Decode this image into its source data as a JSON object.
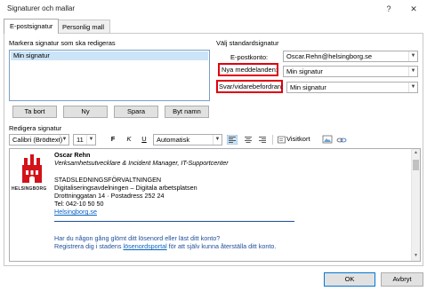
{
  "window": {
    "title": "Signaturer och mallar",
    "help": "?",
    "close": "✕"
  },
  "tabs": [
    {
      "label": "E-postsignatur",
      "active": true
    },
    {
      "label": "Personlig mall",
      "active": false
    }
  ],
  "left": {
    "select_label": "Markera signatur som ska redigeras",
    "signatures": [
      "Min signatur"
    ],
    "buttons": {
      "delete": "Ta bort",
      "new": "Ny",
      "save": "Spara",
      "rename": "Byt namn"
    }
  },
  "right": {
    "group_label": "Välj standardsignatur",
    "account_label": "E-postkonto:",
    "account_value": "Oscar.Rehn@helsingborg.se",
    "new_messages_label": "Nya meddelanden:",
    "new_messages_value": "Min signatur",
    "replies_label": "Svar/vidarebefordran:",
    "replies_value": "Min signatur"
  },
  "editor": {
    "label": "Redigera signatur",
    "font": "Calibri (Brödtext)",
    "size": "11",
    "bold": "F",
    "italic": "K",
    "underline": "U",
    "color": "Automatisk",
    "business_card": "Visitkort"
  },
  "signature": {
    "logo_text": "HELSINGBORG",
    "name": "Oscar Rehn",
    "title": "Verksamhetsutvecklare & Incident Manager, IT-Supportcenter",
    "org": "STADSLEDNINGSFÖRVALTNINGEN",
    "dept": "Digitaliseringsavdelningen – Digitala arbetsplatsen",
    "address": "Drottninggatan 14 · Postadress 252 24",
    "phone": "Tel: 042-10 50 50",
    "website": "Helsingborg.se",
    "note1": "Har du någon gång glömt ditt lösenord eller läst ditt konto?",
    "note2_pre": "Registrera dig i stadens ",
    "note2_link": "lösenordsportal",
    "note2_post": " för att själv kunna återställa ditt konto."
  },
  "footer": {
    "ok": "OK",
    "cancel": "Avbryt"
  },
  "colors": {
    "highlight": "#e0000f",
    "link": "#0563c1",
    "selection": "#cce4f7"
  }
}
